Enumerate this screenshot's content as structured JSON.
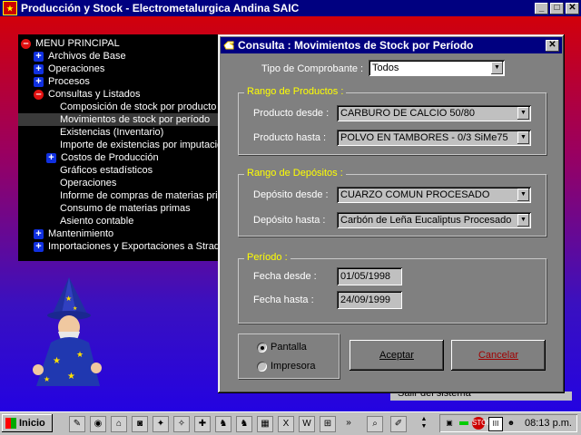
{
  "main_window": {
    "title": "Producción y Stock - Electrometalurgica Andina SAIC",
    "controls": {
      "minimize": "_",
      "maximize": "□",
      "close": "✕"
    }
  },
  "menu_tree": [
    {
      "label": "MENU PRINCIPAL",
      "icon": "minus",
      "level": 0
    },
    {
      "label": "Archivos de Base",
      "icon": "plus",
      "level": 1
    },
    {
      "label": "Operaciones",
      "icon": "plus",
      "level": 1
    },
    {
      "label": "Procesos",
      "icon": "plus",
      "level": 1
    },
    {
      "label": "Consultas y Listados",
      "icon": "minus",
      "level": 1
    },
    {
      "label": "Composición de stock por producto",
      "icon": "",
      "level": 2
    },
    {
      "label": "Movimientos de stock por período",
      "icon": "",
      "level": 2,
      "selected": true
    },
    {
      "label": "Existencias (Inventario)",
      "icon": "",
      "level": 2
    },
    {
      "label": "Importe de existencias por imputació",
      "icon": "",
      "level": 2
    },
    {
      "label": "Costos de Producción",
      "icon": "plus",
      "level": 1.5
    },
    {
      "label": "Gráficos estadísticos",
      "icon": "",
      "level": 2
    },
    {
      "label": "Operaciones",
      "icon": "",
      "level": 2
    },
    {
      "label": "Informe de compras de materias prim",
      "icon": "",
      "level": 2
    },
    {
      "label": "Consumo de materias primas",
      "icon": "",
      "level": 2
    },
    {
      "label": "Asiento contable",
      "icon": "",
      "level": 2
    },
    {
      "label": "Mantenimiento",
      "icon": "plus",
      "level": 1
    },
    {
      "label": "Importaciones y Exportaciones a Strad",
      "icon": "plus",
      "level": 1
    }
  ],
  "background_button_text": "Salir del sistema",
  "dialog": {
    "title": "Consulta : Movimientos de Stock por Período",
    "close": "✕",
    "tipo_label": "Tipo de Comprobante :",
    "tipo_value": "Todos",
    "productos": {
      "title": "Rango de Productos :",
      "desde_label": "Producto desde :",
      "desde_value": "CARBURO DE CALCIO 50/80",
      "hasta_label": "Producto hasta :",
      "hasta_value": "POLVO EN TAMBORES - 0/3 SiMe75"
    },
    "depositos": {
      "title": "Rango de Depósitos :",
      "desde_label": "Depósito desde :",
      "desde_value": "CUARZO COMUN PROCESADO",
      "hasta_label": "Depósito hasta :",
      "hasta_value": "Carbón de Leña Eucaliptus Procesado"
    },
    "periodo": {
      "title": "Período :",
      "desde_label": "Fecha desde :",
      "desde_value": "01/05/1998",
      "hasta_label": "Fecha hasta :",
      "hasta_value": "24/09/1999"
    },
    "output": {
      "pantalla": "Pantalla",
      "impresora": "Impresora",
      "selected": "pantalla"
    },
    "accept": "Aceptar",
    "cancel": "Cancelar"
  },
  "taskbar": {
    "start": "Inicio",
    "clock": "08:13 p.m.",
    "quick_icons": [
      "pen-icon",
      "explorer-icon",
      "network-icon",
      "camera-icon",
      "gear-icon",
      "puzzle-icon",
      "tools-icon",
      "fox-icon",
      "fox2-icon",
      "fox3-icon",
      "desktop-icon",
      "excel-icon",
      "word-icon",
      "windows-icon",
      "chevron-right-icon",
      "search-doc-icon",
      "edit-doc-icon"
    ],
    "tray_text": [
      "STOP",
      "III"
    ]
  },
  "colors": {
    "title_bar": "#000080",
    "dialog_bg": "#808080",
    "group_title": "#ffff00",
    "menu_bg": "#000000"
  }
}
